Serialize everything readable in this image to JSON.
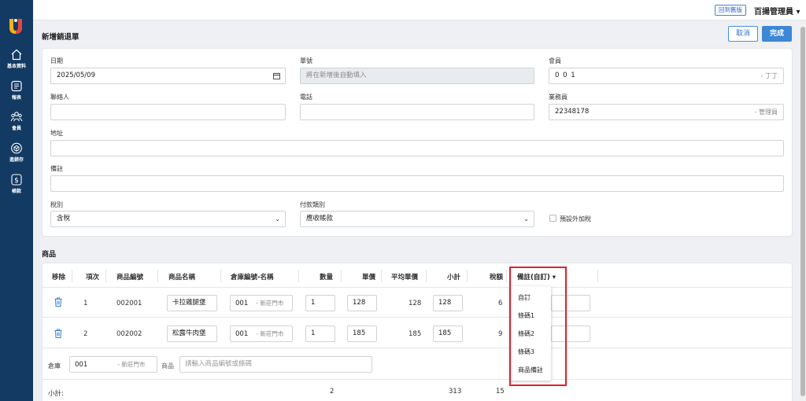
{
  "topbar": {
    "back_to_old": "回到舊版",
    "user": "百揚管理員 ▾"
  },
  "sidebar": {
    "items": [
      {
        "label": "基本資料",
        "icon": "home-icon"
      },
      {
        "label": "報表",
        "icon": "report-icon"
      },
      {
        "label": "會員",
        "icon": "members-icon"
      },
      {
        "label": "進銷存",
        "icon": "box-icon"
      },
      {
        "label": "帳款",
        "icon": "dollar-icon"
      }
    ]
  },
  "page": {
    "title": "新增銷退單",
    "cancel": "取消",
    "done": "完成"
  },
  "form": {
    "date": {
      "label": "日期",
      "value": "2025/05/09"
    },
    "order_no": {
      "label": "單號",
      "placeholder": "將在新增後自動填入"
    },
    "member": {
      "label": "會員",
      "value": "0 0 1",
      "suffix": "- 丁丁"
    },
    "contact": {
      "label": "聯絡人",
      "value": ""
    },
    "phone": {
      "label": "電話",
      "value": ""
    },
    "salesperson": {
      "label": "業務員",
      "value": "22348178",
      "suffix": "- 管理員"
    },
    "address": {
      "label": "地址",
      "value": ""
    },
    "note": {
      "label": "備註",
      "value": ""
    },
    "tax_type": {
      "label": "稅別",
      "value": "含稅"
    },
    "payment_type": {
      "label": "付款類別",
      "value": "應收帳款"
    },
    "extra_tax": {
      "label": "預設外加稅"
    }
  },
  "products": {
    "title": "商品",
    "headers": {
      "remove": "移除",
      "seq": "項次",
      "code": "商品編號",
      "name": "商品名稱",
      "warehouse": "倉庫編號-名稱",
      "qty": "數量",
      "price": "單價",
      "avg_price": "平均單價",
      "subtotal": "小計",
      "tax": "稅額",
      "note": "備註(自訂) ▾"
    },
    "rows": [
      {
        "seq": "1",
        "code": "002001",
        "name": "卡拉雞腿堡",
        "wh_code": "001",
        "wh_name": "- 新莊門市",
        "qty": "1",
        "price": "128",
        "avg_price": "128",
        "subtotal": "128",
        "tax": "6"
      },
      {
        "seq": "2",
        "code": "002002",
        "name": "松露牛肉堡",
        "wh_code": "001",
        "wh_name": "- 新莊門市",
        "qty": "1",
        "price": "185",
        "avg_price": "185",
        "subtotal": "185",
        "tax": "9"
      }
    ],
    "add_row": {
      "warehouse_label": "倉庫",
      "warehouse_code": "001",
      "warehouse_name": "- 新莊門市",
      "product_label": "商品",
      "product_placeholder": "請輸入商品編號或條碼"
    },
    "totals": {
      "label": "小計:",
      "qty": "2",
      "subtotal": "313",
      "tax": "15"
    }
  },
  "note_dropdown": {
    "options": [
      "自訂",
      "條碼1",
      "條碼2",
      "條碼3",
      "商品備註"
    ]
  }
}
